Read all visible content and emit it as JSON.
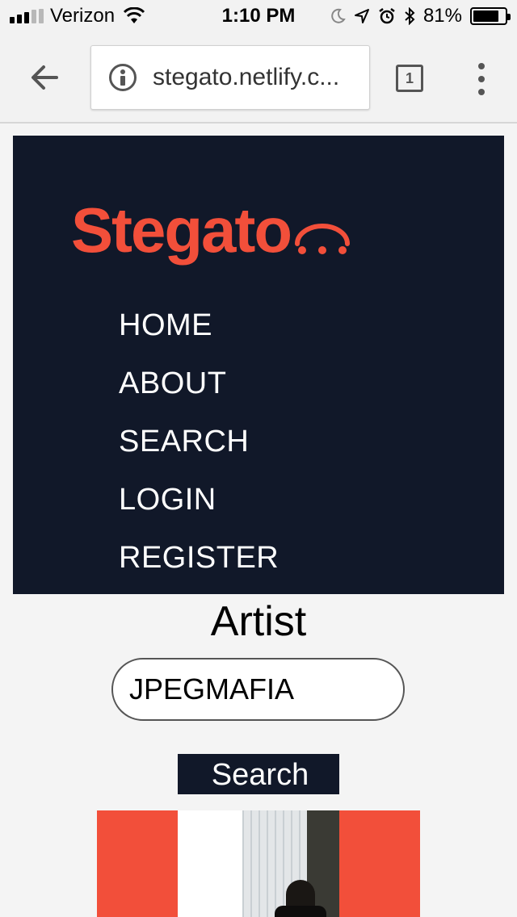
{
  "status_bar": {
    "carrier": "Verizon",
    "time": "1:10 PM",
    "battery": "81%",
    "battery_level": 0.81,
    "icons": [
      "signal-icon",
      "wifi-icon",
      "moon-icon",
      "location-icon",
      "alarm-icon",
      "bluetooth-icon",
      "battery-icon"
    ]
  },
  "browser": {
    "url": "stegato.netlify.c...",
    "tab_count": "1",
    "icons": [
      "back-arrow-icon",
      "info-icon",
      "tabs-icon",
      "overflow-menu-icon"
    ]
  },
  "site": {
    "logo": "Stegato",
    "brand_color": "#f24f3a",
    "nav_background": "#111829",
    "nav": [
      {
        "label": "HOME"
      },
      {
        "label": "ABOUT"
      },
      {
        "label": "SEARCH"
      },
      {
        "label": "LOGIN"
      },
      {
        "label": "REGISTER"
      }
    ]
  },
  "search_form": {
    "label": "Artist",
    "input_value": "JPEGMAFIA",
    "button_label": "Search"
  }
}
